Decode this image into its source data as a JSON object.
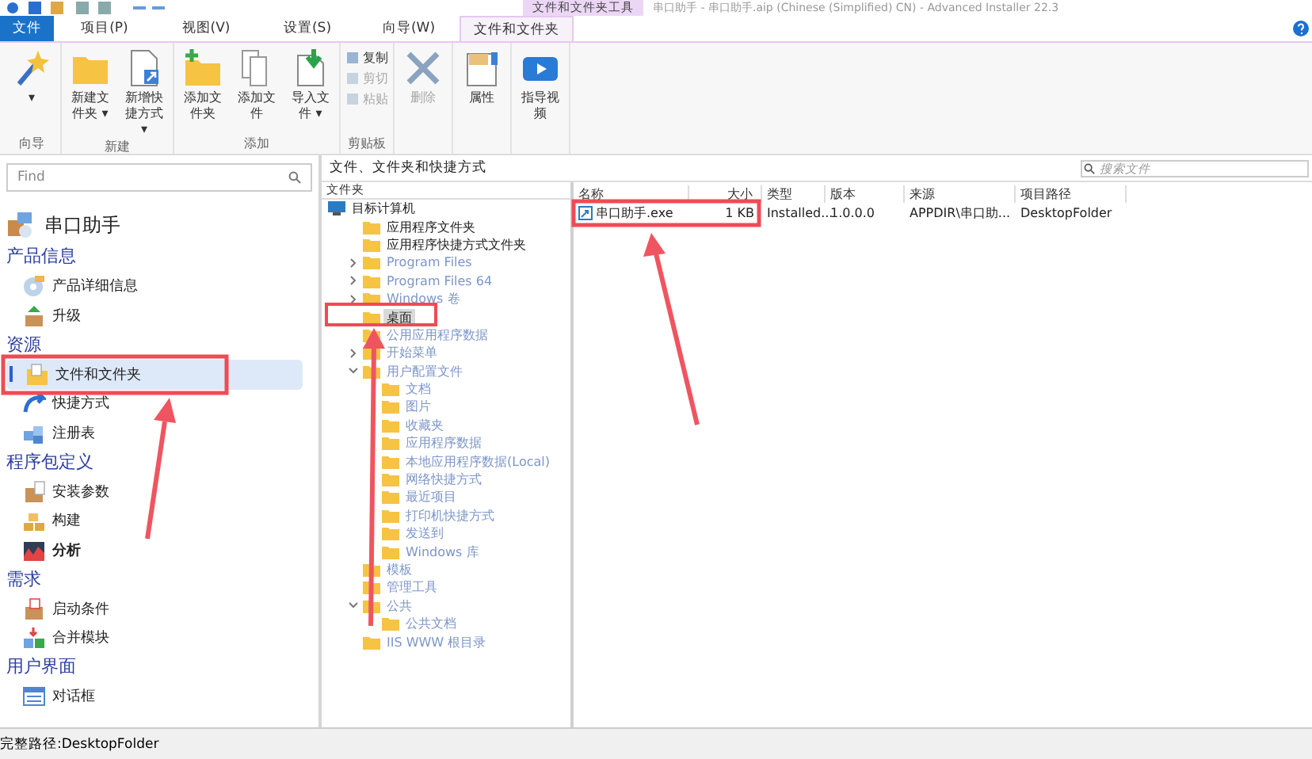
{
  "window": {
    "title": "串口助手 - 串口助手.aip (Chinese (Simplified) CN) - Advanced Installer 22.3",
    "context_label": "文件和文件夹工具"
  },
  "tabs": [
    {
      "label": "文件",
      "kind": "file",
      "selected": false
    },
    {
      "label": "项目(P)",
      "kind": "tab",
      "selected": false
    },
    {
      "label": "视图(V)",
      "kind": "tab",
      "selected": false
    },
    {
      "label": "设置(S)",
      "kind": "tab",
      "selected": false
    },
    {
      "label": "向导(W)",
      "kind": "tab",
      "selected": false
    },
    {
      "label": "文件和文件夹",
      "kind": "tab",
      "selected": true
    }
  ],
  "ribbon": [
    {
      "label": "向导",
      "buttons": [
        {
          "kind": "wizard",
          "label": "▾",
          "disabled": false
        }
      ]
    },
    {
      "label": "新建",
      "buttons": [
        {
          "kind": "folder",
          "label": "新建文件夹 ▾",
          "disabled": false
        },
        {
          "kind": "shortcut",
          "label": "新增快捷方式 ▾",
          "disabled": false
        }
      ]
    },
    {
      "label": "添加",
      "buttons": [
        {
          "kind": "addfolder",
          "label": "添加文件夹",
          "disabled": false
        },
        {
          "kind": "addfile",
          "label": "添加文件",
          "disabled": false
        },
        {
          "kind": "import",
          "label": "导入文件 ▾",
          "disabled": false
        }
      ]
    },
    {
      "label": "剪贴板",
      "buttons": [
        {
          "kind": "small",
          "label": "复制",
          "disabled": false
        },
        {
          "kind": "small",
          "label": "剪切",
          "disabled": true
        },
        {
          "kind": "small",
          "label": "粘贴",
          "disabled": true
        }
      ]
    },
    {
      "buttons": [
        {
          "kind": "delete",
          "label": "删除",
          "disabled": true
        }
      ]
    },
    {
      "buttons": [
        {
          "kind": "props",
          "label": "属性",
          "disabled": false
        }
      ]
    },
    {
      "buttons": [
        {
          "kind": "video",
          "label": "指导视频",
          "disabled": false
        }
      ]
    }
  ],
  "sidebar": {
    "search": {
      "placeholder": "Find"
    },
    "project": "串口助手",
    "groups": [
      {
        "heading": "产品信息",
        "items": [
          {
            "label": "产品详细信息",
            "selected": false,
            "bold": false
          },
          {
            "label": "升级",
            "selected": false,
            "bold": false
          }
        ]
      },
      {
        "heading": "资源",
        "items": [
          {
            "label": "文件和文件夹",
            "selected": true,
            "bold": false
          },
          {
            "label": "快捷方式",
            "selected": false,
            "bold": false
          },
          {
            "label": "注册表",
            "selected": false,
            "bold": false
          }
        ]
      },
      {
        "heading": "程序包定义",
        "items": [
          {
            "label": "安装参数",
            "selected": false,
            "bold": false
          },
          {
            "label": "构建",
            "selected": false,
            "bold": false
          },
          {
            "label": "分析",
            "selected": false,
            "bold": true
          }
        ]
      },
      {
        "heading": "需求",
        "items": [
          {
            "label": "启动条件",
            "selected": false,
            "bold": false
          },
          {
            "label": "合并模块",
            "selected": false,
            "bold": false
          }
        ]
      },
      {
        "heading": "用户界面",
        "items": [
          {
            "label": "对话框",
            "selected": false,
            "bold": false
          }
        ]
      }
    ]
  },
  "panel": {
    "title": "文件、文件夹和快捷方式",
    "search": {
      "placeholder": "搜索文件"
    }
  },
  "tree": {
    "header": "文件夹",
    "root": "目标计算机",
    "children": [
      {
        "label": "应用程序文件夹",
        "dim": false,
        "selected": false
      },
      {
        "label": "应用程序快捷方式文件夹",
        "dim": false,
        "selected": false
      },
      {
        "label": "Program Files",
        "dim": true,
        "selected": false,
        "expanded": false
      },
      {
        "label": "Program Files 64",
        "dim": true,
        "selected": false,
        "expanded": false
      },
      {
        "label": "Windows 卷",
        "dim": true,
        "selected": false,
        "expanded": false
      },
      {
        "label": "桌面",
        "dim": false,
        "selected": true
      },
      {
        "label": "公用应用程序数据",
        "dim": true,
        "selected": false
      },
      {
        "label": "开始菜单",
        "dim": true,
        "selected": false,
        "expanded": false
      },
      {
        "label": "用户配置文件",
        "dim": true,
        "selected": false,
        "expanded": true,
        "children": [
          {
            "label": "文档",
            "dim": true,
            "selected": false
          },
          {
            "label": "图片",
            "dim": true,
            "selected": false
          },
          {
            "label": "收藏夹",
            "dim": true,
            "selected": false
          },
          {
            "label": "应用程序数据",
            "dim": true,
            "selected": false
          },
          {
            "label": "本地应用程序数据(Local)",
            "dim": true,
            "selected": false
          },
          {
            "label": "网络快捷方式",
            "dim": true,
            "selected": false
          },
          {
            "label": "最近项目",
            "dim": true,
            "selected": false
          },
          {
            "label": "打印机快捷方式",
            "dim": true,
            "selected": false
          },
          {
            "label": "发送到",
            "dim": true,
            "selected": false
          },
          {
            "label": "Windows 库",
            "dim": true,
            "selected": false
          }
        ]
      },
      {
        "label": "模板",
        "dim": true,
        "selected": false
      },
      {
        "label": "管理工具",
        "dim": true,
        "selected": false
      },
      {
        "label": "公共",
        "dim": true,
        "selected": false,
        "expanded": true,
        "children": [
          {
            "label": "公共文档",
            "dim": true,
            "selected": false
          }
        ]
      },
      {
        "label": "IIS WWW 根目录",
        "dim": true,
        "selected": false
      }
    ]
  },
  "table": {
    "columns": [
      "名称",
      "大小",
      "类型",
      "版本",
      "来源",
      "项目路径"
    ],
    "rows": [
      [
        "串口助手.exe",
        "1 KB",
        "Installed...",
        "1.0.0.0",
        "APPDIR\\串口助...",
        "DesktopFolder"
      ]
    ]
  },
  "status_bar": "完整路径:DesktopFolder"
}
